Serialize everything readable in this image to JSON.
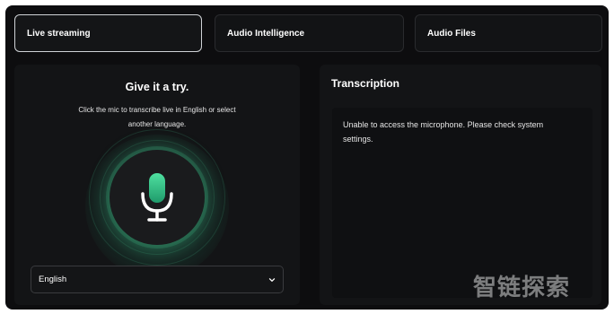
{
  "tabs": [
    {
      "label": "Live streaming",
      "active": true
    },
    {
      "label": "Audio Intelligence",
      "active": false
    },
    {
      "label": "Audio Files",
      "active": false
    }
  ],
  "try_panel": {
    "title": "Give it a try.",
    "subtitle_line1": "Click the mic to transcribe live in English or select",
    "subtitle_line2": "another language.",
    "mic_icon": "microphone-icon",
    "accent_color": "#3ecf8e",
    "language_select": {
      "value": "English",
      "icon": "chevron-down-icon"
    }
  },
  "transcription_panel": {
    "title": "Transcription",
    "message_line1": "Unable to access the microphone. Please check system",
    "message_line2": "settings."
  },
  "watermark": "智链探索"
}
